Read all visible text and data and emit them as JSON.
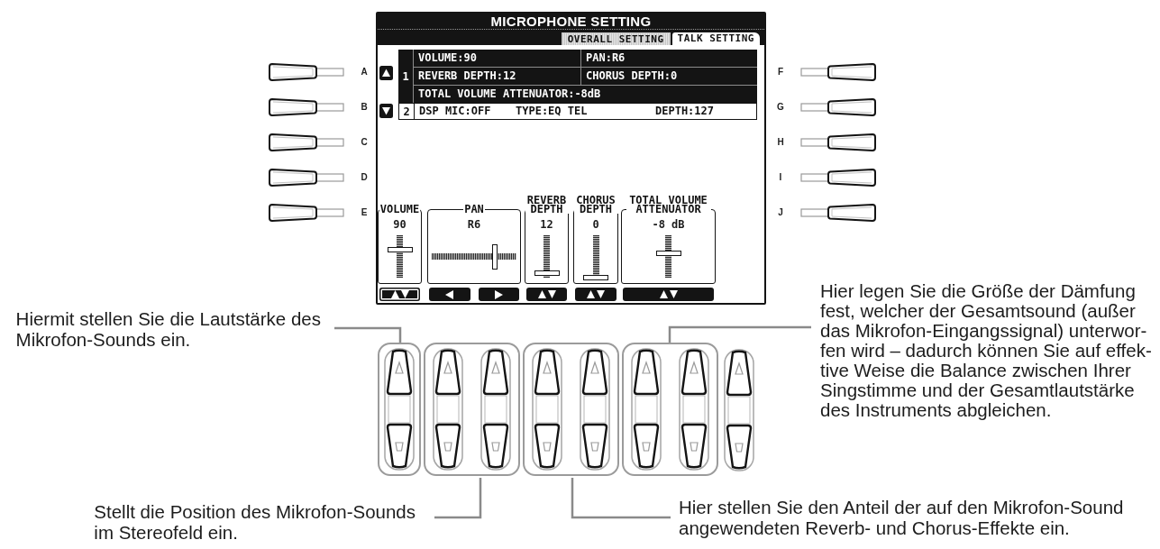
{
  "screen": {
    "title": "MICROPHONE SETTING",
    "tabs": [
      {
        "label": "OVERALL SETTING",
        "selected": false
      },
      {
        "label": "TALK SETTING",
        "selected": true
      }
    ],
    "entries": [
      {
        "number": "1",
        "selected": true,
        "lines": [
          [
            "VOLUME:90",
            "PAN:R6"
          ],
          [
            "REVERB DEPTH:12",
            "CHORUS DEPTH:0"
          ],
          [
            "TOTAL VOLUME ATTENUATOR:-8dB"
          ]
        ]
      },
      {
        "number": "2",
        "selected": false,
        "lines": [
          [
            "DSP MIC:OFF",
            "TYPE:EQ TEL",
            "DEPTH:127"
          ]
        ]
      }
    ],
    "controls": [
      {
        "label": "VOLUME",
        "value": "90",
        "kind": "vertical",
        "level": 0.66,
        "buttons": [
          {
            "kind": "up_down",
            "selected": true
          }
        ]
      },
      {
        "label": "PAN",
        "value": "R6",
        "kind": "horizontal",
        "level": 0.74,
        "buttons": [
          {
            "kind": "left",
            "selected": false
          },
          {
            "kind": "right",
            "selected": false
          }
        ]
      },
      {
        "label": "REVERB DEPTH",
        "value": "12",
        "kind": "vertical",
        "level": 0.1,
        "buttons": [
          {
            "kind": "up_down",
            "selected": false
          }
        ]
      },
      {
        "label": "CHORUS DEPTH",
        "value": "0",
        "kind": "vertical",
        "level": 0,
        "buttons": [
          {
            "kind": "up_down",
            "selected": false
          }
        ]
      },
      {
        "label": "TOTAL VOLUME ATTENUATOR",
        "value": "-8 dB",
        "kind": "vertical",
        "level": 0.57,
        "buttons": [
          {
            "kind": "up_down",
            "selected": false
          }
        ]
      }
    ]
  },
  "left_buttons": [
    "A",
    "B",
    "C",
    "D",
    "E"
  ],
  "right_buttons": [
    "F",
    "G",
    "H",
    "I",
    "J"
  ],
  "panel": {
    "groups": [
      {
        "buttons": [
          {
            "kind": "up_down"
          }
        ]
      },
      {
        "buttons": [
          {
            "kind": "up_down"
          },
          {
            "kind": "up_down"
          }
        ]
      },
      {
        "buttons": [
          {
            "kind": "up_down"
          },
          {
            "kind": "up_down"
          }
        ]
      },
      {
        "buttons": [
          {
            "kind": "up_down"
          },
          {
            "kind": "up_down"
          }
        ]
      }
    ],
    "single_buttons": [
      {
        "kind": "up_down"
      }
    ]
  },
  "callouts": [
    {
      "text": "Hier legen Sie die Größe der Dämfung\nfest, welcher der Gesamtsound (außer\ndas Mikrofon-Eingangssignal) unterwor-\nfen wird – dadurch können Sie auf effek-\ntive Weise die Balance zwischen Ihrer\nSingstimme und der Gesamtlautstärke\ndes Instruments abgleichen."
    },
    {
      "text": "Hiermit stellen Sie die Lautstärke des\nMikrofon-Sounds ein."
    },
    {
      "text": "Stellt die Position des Mikrofon-Sounds\nim Stereofeld ein."
    },
    {
      "text": "Hier stellen Sie den Anteil der auf den Mikrofon-Sound\nangewendeten Reverb- und Chorus-Effekte ein."
    }
  ]
}
